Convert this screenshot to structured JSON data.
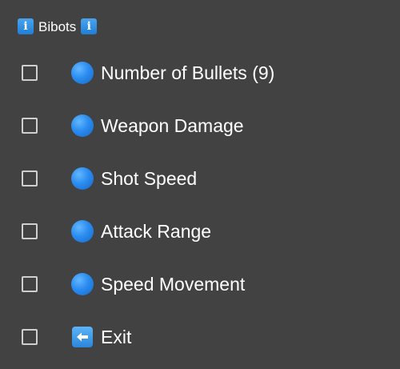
{
  "header": {
    "title": "Bibots",
    "left_icon": "info-icon",
    "right_icon": "info-icon",
    "info_glyph": "i"
  },
  "menu": {
    "items": [
      {
        "label": "Number of Bullets (9)",
        "icon": "blue-circle-icon",
        "checked": false
      },
      {
        "label": "Weapon Damage",
        "icon": "blue-circle-icon",
        "checked": false
      },
      {
        "label": "Shot Speed",
        "icon": "blue-circle-icon",
        "checked": false
      },
      {
        "label": "Attack Range",
        "icon": "blue-circle-icon",
        "checked": false
      },
      {
        "label": "Speed Movement",
        "icon": "blue-circle-icon",
        "checked": false
      },
      {
        "label": "Exit",
        "icon": "back-arrow-icon",
        "checked": false
      }
    ]
  },
  "colors": {
    "background": "#424242",
    "accent": "#2b8cf0",
    "text": "#ffffff",
    "checkbox_border": "#cfcfcf"
  }
}
